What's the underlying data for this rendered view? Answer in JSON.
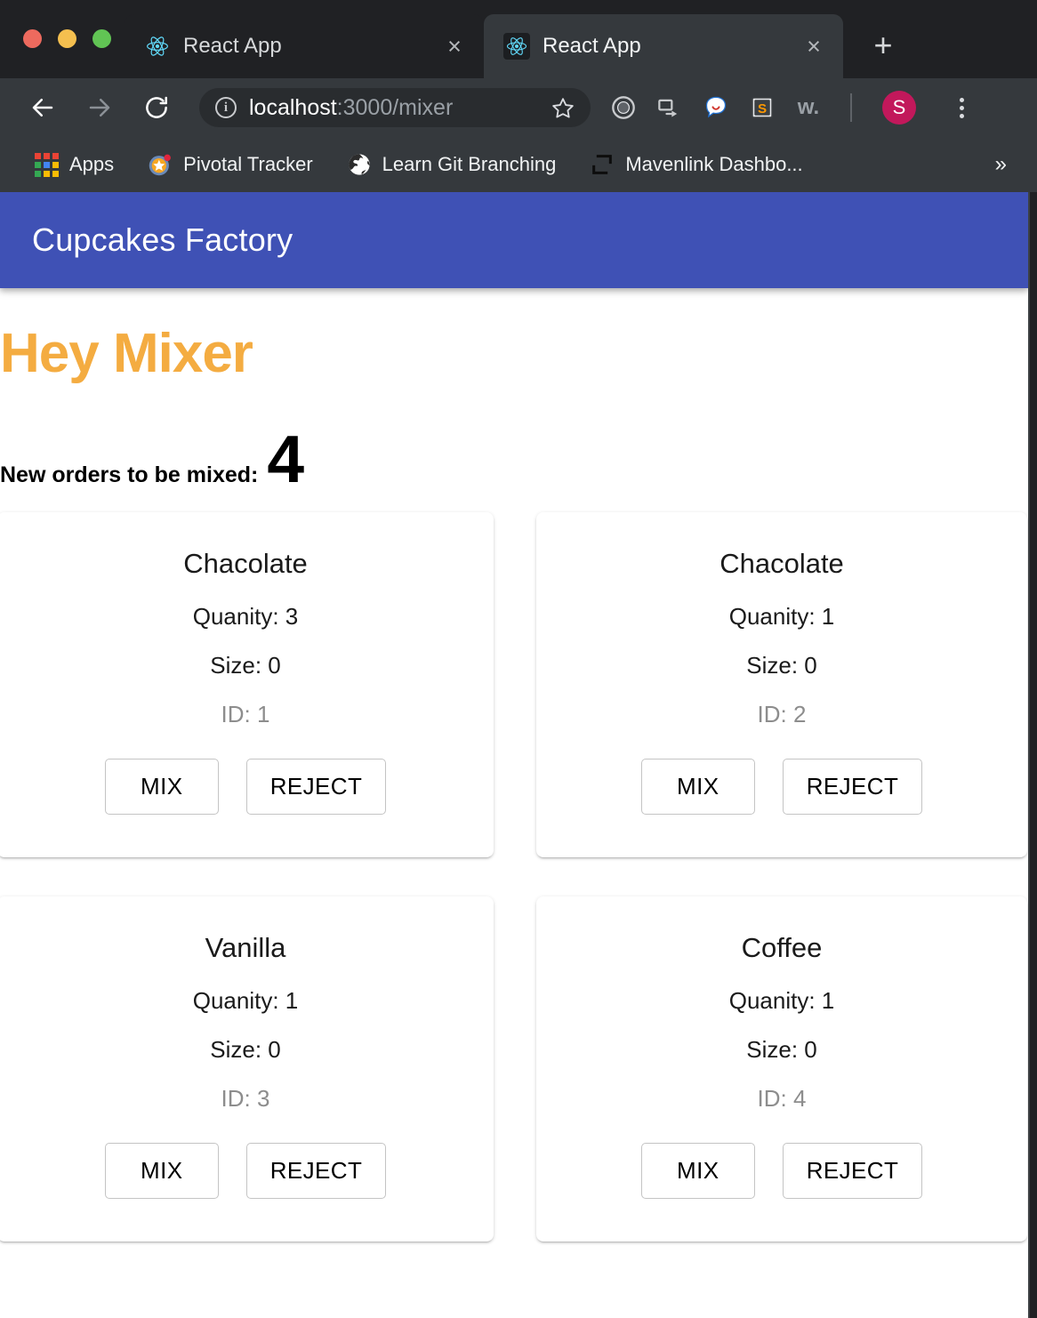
{
  "browser": {
    "tabs": [
      {
        "title": "React App",
        "favicon": "react-icon",
        "active": false,
        "close_label": "×"
      },
      {
        "title": "React App",
        "favicon": "react-icon",
        "active": true,
        "close_label": "×"
      }
    ],
    "new_tab_label": "+",
    "toolbar": {
      "back_icon": "arrow-left-icon",
      "forward_icon": "arrow-right-icon",
      "reload_icon": "reload-icon",
      "omnibox": {
        "info_icon": "info-circle-icon",
        "info_label": "i",
        "url_host": "localhost",
        "url_path": ":3000/mixer",
        "star_icon": "star-outline-icon",
        "star_glyph": "☆"
      },
      "extensions": [
        {
          "name": "ring-extension-icon",
          "glyph": "◉"
        },
        {
          "name": "screencast-extension-icon",
          "glyph": "⬚"
        },
        {
          "name": "chat-bubble-extension-icon",
          "glyph": "●"
        },
        {
          "name": "sublime-s-extension-icon",
          "glyph": "S"
        },
        {
          "name": "w-dot-extension-icon",
          "glyph": "w."
        }
      ],
      "avatar_initial": "S",
      "menu_icon": "three-dot-menu-icon"
    },
    "bookmarks": [
      {
        "label": "Apps",
        "icon": "apps-grid-icon"
      },
      {
        "label": "Pivotal Tracker",
        "icon": "pivotal-tracker-icon"
      },
      {
        "label": "Learn Git Branching",
        "icon": "globe-icon"
      },
      {
        "label": "Mavenlink Dashbo...",
        "icon": "mavenlink-brackets-icon"
      }
    ],
    "bookmarks_overflow": "»"
  },
  "app": {
    "appbar_title": "Cupcakes Factory",
    "accent_blue": "#3f51b5",
    "heading": "Hey Mixer",
    "heading_color": "#f4ac41",
    "orders_label": "New orders to be mixed:",
    "orders_count": "4",
    "buttons": {
      "mix": "MIX",
      "reject": "REJECT"
    },
    "cards": [
      {
        "flavor": "Chacolate",
        "quantity": "Quanity: 3",
        "size": "Size: 0",
        "id": "ID: 1"
      },
      {
        "flavor": "Chacolate",
        "quantity": "Quanity: 1",
        "size": "Size: 0",
        "id": "ID: 2"
      },
      {
        "flavor": "Vanilla",
        "quantity": "Quanity: 1",
        "size": "Size: 0",
        "id": "ID: 3"
      },
      {
        "flavor": "Coffee",
        "quantity": "Quanity: 1",
        "size": "Size: 0",
        "id": "ID: 4"
      }
    ]
  }
}
